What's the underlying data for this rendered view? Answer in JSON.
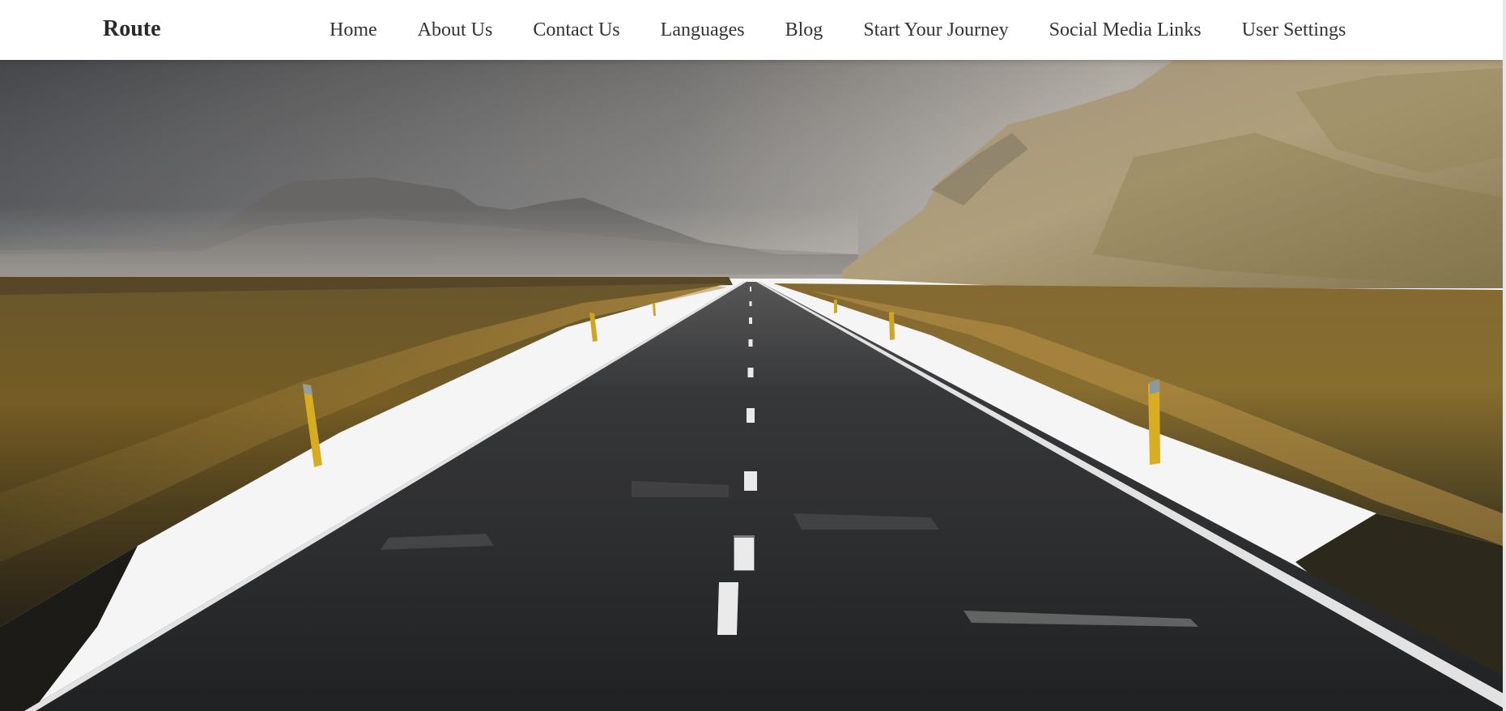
{
  "brand": {
    "name": "Route"
  },
  "nav": {
    "items": [
      {
        "label": "Home"
      },
      {
        "label": "About Us"
      },
      {
        "label": "Contact Us"
      },
      {
        "label": "Languages"
      },
      {
        "label": "Blog"
      },
      {
        "label": "Start Your Journey"
      },
      {
        "label": "Social Media Links"
      },
      {
        "label": "User Settings"
      }
    ]
  },
  "hero": {
    "image": "road-through-grassland-mountains",
    "colors": {
      "sky_left": "#5a5c60",
      "sky_right": "#d8cfc4",
      "mountain": "#6e6b68",
      "hillside": "#b8a585",
      "grass": "#8a6d2a",
      "asphalt": "#2a2b2d",
      "road_line": "#f2f2f2",
      "marker_post": "#e2b524"
    }
  }
}
